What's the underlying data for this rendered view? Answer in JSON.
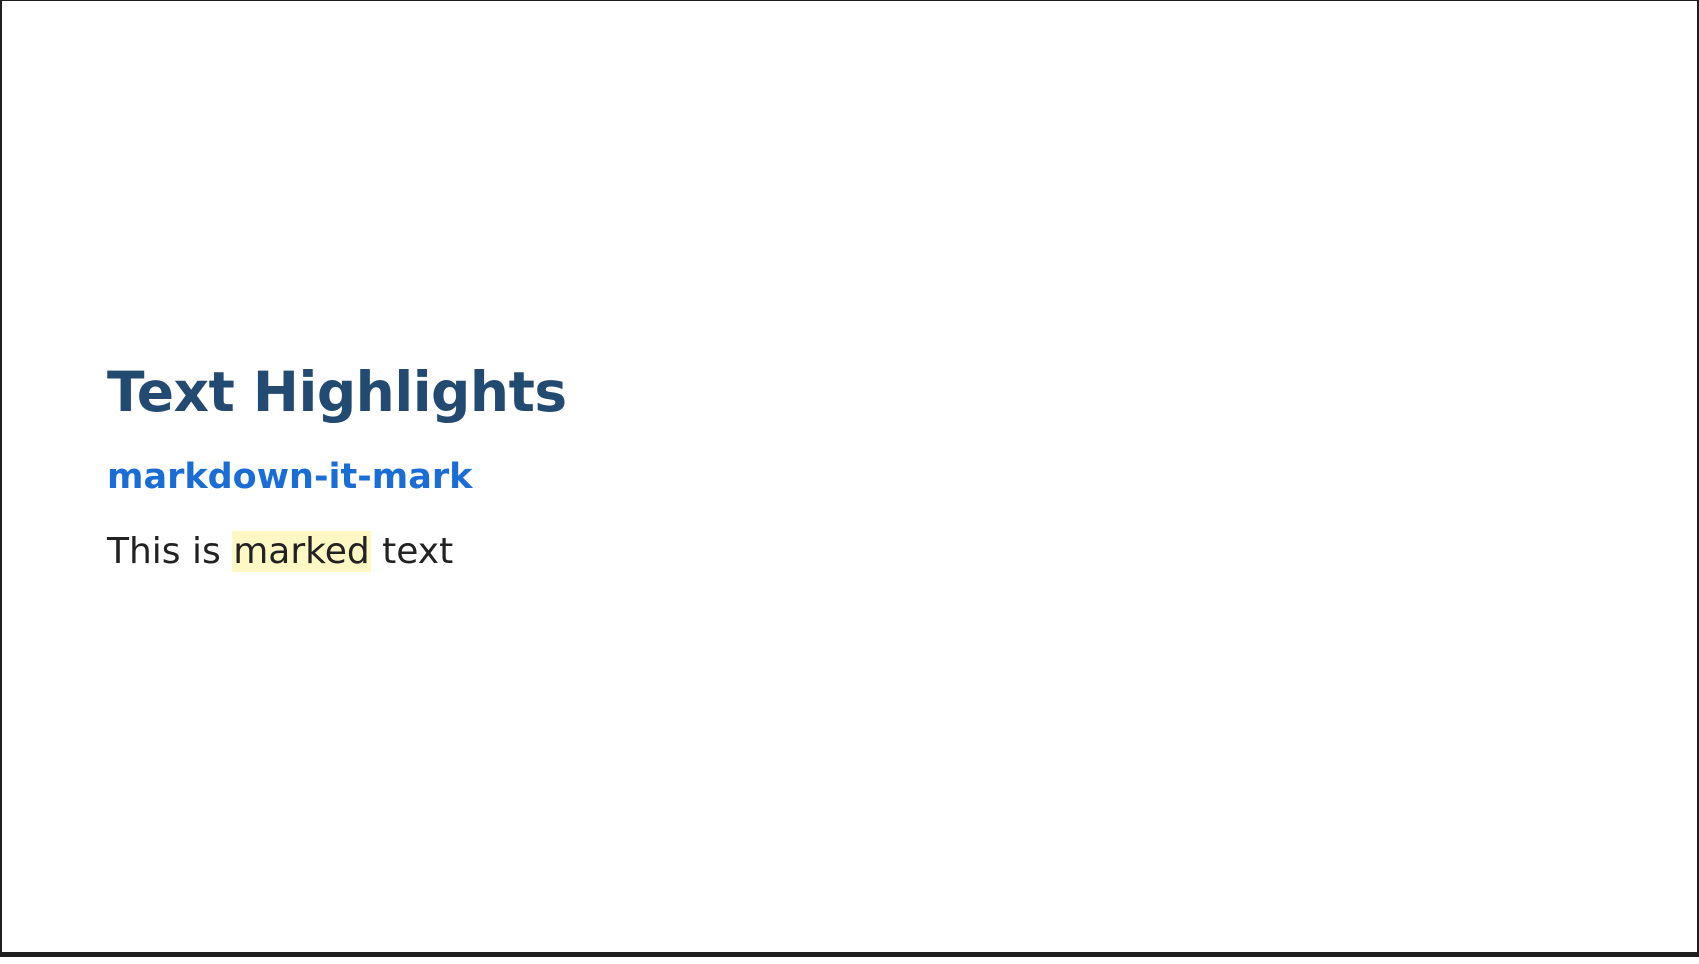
{
  "slide": {
    "title": "Text Highlights",
    "link_text": "markdown-it-mark",
    "paragraph": {
      "before": "This is ",
      "marked": "marked",
      "after": " text"
    }
  },
  "colors": {
    "title": "#234a71",
    "link": "#1a6dd5",
    "text": "#222222",
    "highlight": "#fff8c5",
    "border": "#1f1f1f"
  }
}
